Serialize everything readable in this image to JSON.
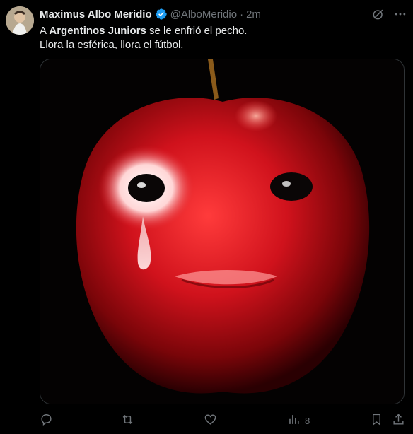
{
  "tweet": {
    "author_name": "Maximus Albo Meridio",
    "handle": "@AlboMeridio",
    "separator": "·",
    "time": "2m",
    "text_prefix": "A ",
    "text_bold": "Argentinos Juniors",
    "text_suffix": " se le enfrió el pecho.",
    "text_line2": "Llora la esférica, llora el fútbol."
  },
  "actions": {
    "views_count": "8"
  },
  "colors": {
    "background": "#000000",
    "text": "#e7e9ea",
    "secondary": "#71767b",
    "verified": "#1d9bf0",
    "apple_red": "#c8101e"
  },
  "icons": [
    "verified-badge-icon",
    "grok-icon",
    "more-icon",
    "reply-icon",
    "retweet-icon",
    "like-icon",
    "views-icon",
    "bookmark-icon",
    "share-icon"
  ]
}
